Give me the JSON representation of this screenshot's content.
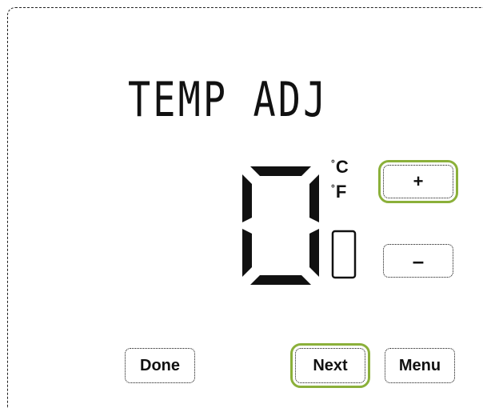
{
  "screen": {
    "title": "TEMP ADJ",
    "value": "0",
    "value_small": "0",
    "unit_celsius": "C",
    "unit_fahrenheit": "F",
    "degree_symbol": "°"
  },
  "buttons": {
    "plus": "+",
    "minus": "–",
    "done": "Done",
    "next": "Next",
    "menu": "Menu"
  },
  "colors": {
    "highlight": "#8bb03a",
    "ink": "#111111"
  }
}
